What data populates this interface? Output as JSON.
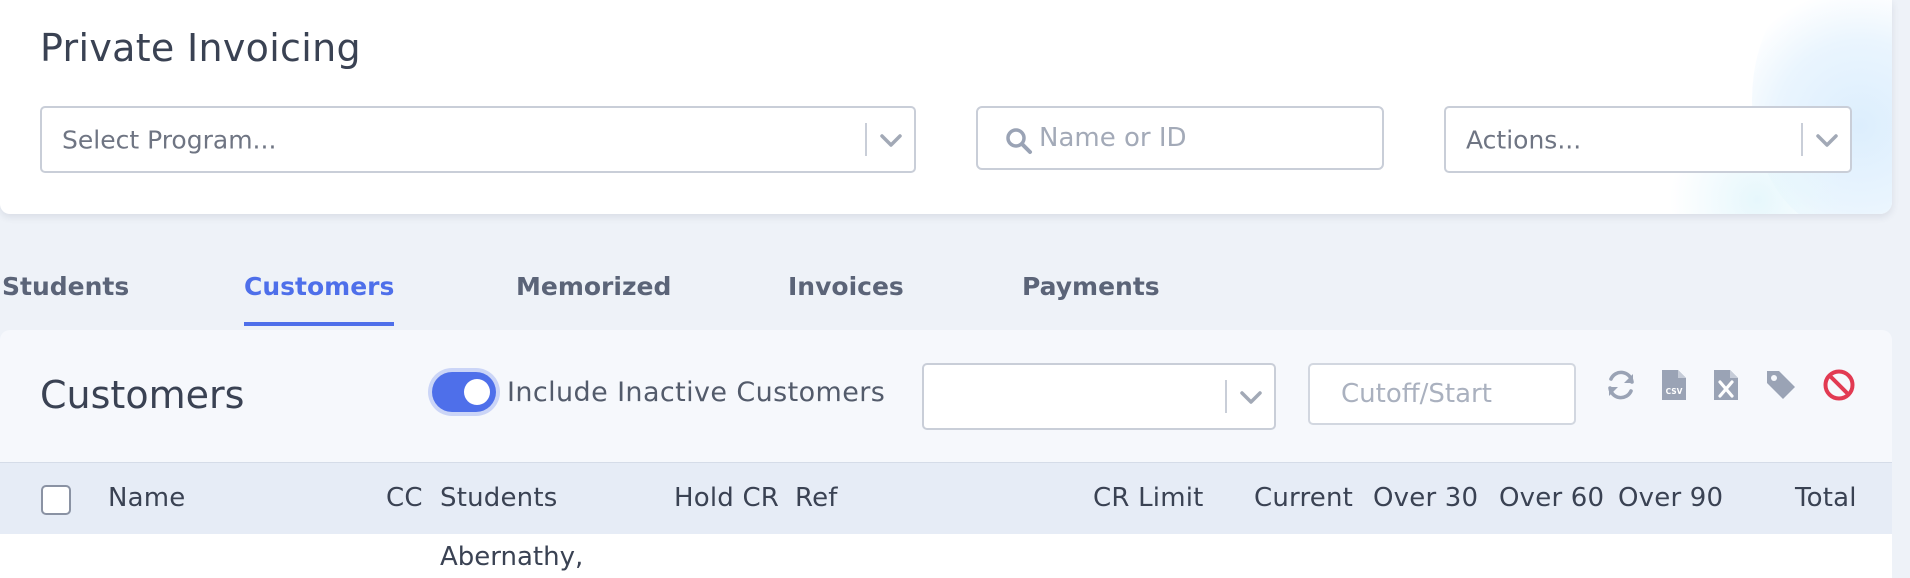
{
  "header": {
    "title": "Private Invoicing",
    "program_select": {
      "placeholder": "Select Program..."
    },
    "search": {
      "placeholder": "Name or ID"
    },
    "actions_select": {
      "placeholder": "Actions..."
    }
  },
  "tabs": [
    {
      "label": "Students",
      "active": false
    },
    {
      "label": "Customers",
      "active": true
    },
    {
      "label": "Memorized",
      "active": false
    },
    {
      "label": "Invoices",
      "active": false
    },
    {
      "label": "Payments",
      "active": false
    }
  ],
  "panel": {
    "title": "Customers",
    "include_inactive": {
      "label": "Include Inactive Customers",
      "checked": true
    },
    "filter_select": {
      "value": ""
    },
    "cutoff": {
      "placeholder": "Cutoff/Start"
    },
    "toolbar": [
      {
        "icon": "refresh-icon"
      },
      {
        "icon": "csv-file-icon"
      },
      {
        "icon": "excel-file-icon"
      },
      {
        "icon": "tag-icon"
      },
      {
        "icon": "ban-icon"
      }
    ]
  },
  "table": {
    "columns": [
      "Name",
      "CC",
      "Students",
      "Hold CR",
      "Ref",
      "CR Limit",
      "Current",
      "Over 30",
      "Over 60",
      "Over 90",
      "Total"
    ],
    "rows": [
      {
        "students": "Abernathy,"
      }
    ]
  },
  "colors": {
    "accent": "#4e6fea",
    "danger": "#e23a52",
    "icon_gray": "#9aa3b5"
  }
}
